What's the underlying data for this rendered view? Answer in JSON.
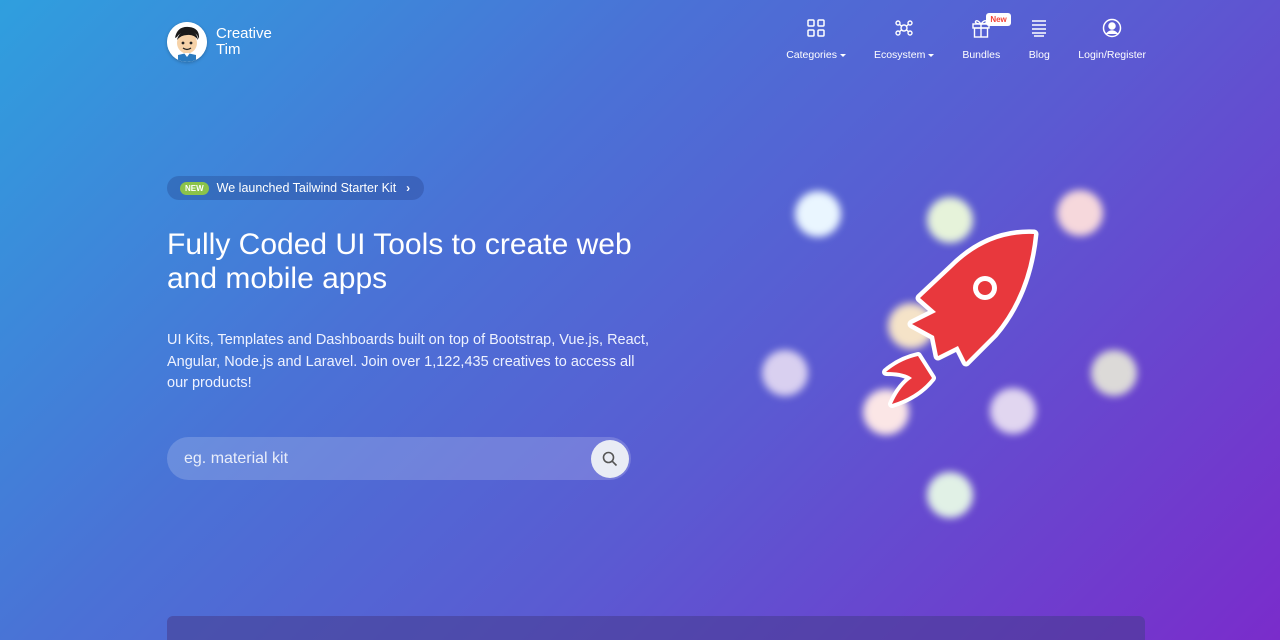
{
  "brand": {
    "line1": "Creative",
    "line2": "Tim"
  },
  "nav": {
    "items": [
      {
        "label": "Categories",
        "icon": "grid-icon",
        "dropdown": true
      },
      {
        "label": "Ecosystem",
        "icon": "network-icon",
        "dropdown": true
      },
      {
        "label": "Bundles",
        "icon": "gift-icon",
        "badge": "New"
      },
      {
        "label": "Blog",
        "icon": "list-icon"
      },
      {
        "label": "Login/Register",
        "icon": "user-icon"
      }
    ]
  },
  "hero": {
    "announcement": {
      "badge": "NEW",
      "text": "We launched Tailwind Starter Kit"
    },
    "title": "Fully Coded UI Tools to create web and mobile apps",
    "description": "UI Kits, Templates and Dashboards built on top of Bootstrap, Vue.js, React, Angular, Node.js and Laravel. Join over 1,122,435 creatives to access all our products!",
    "search": {
      "placeholder": "eg. material kit",
      "value": ""
    }
  },
  "colors": {
    "gradient_start": "#2f9fde",
    "gradient_end": "#7a2ccb",
    "rocket": "#e8383d",
    "new_badge_text": "#f44336",
    "pill_badge": "#8bc34a"
  }
}
